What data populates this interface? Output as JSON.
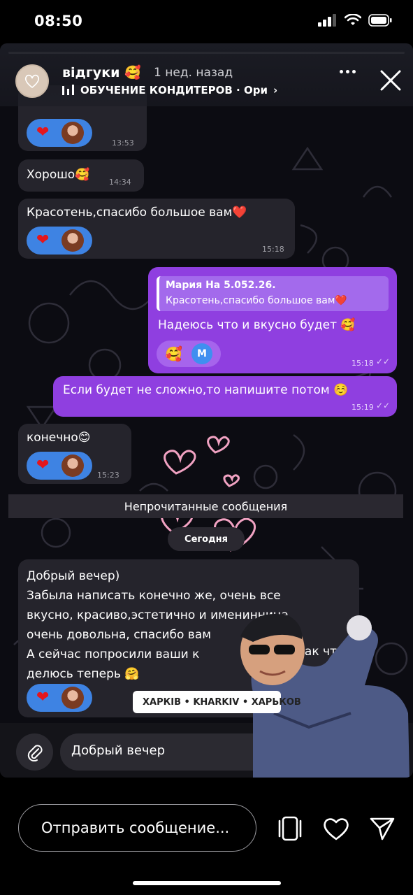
{
  "status_bar": {
    "time": "08:50"
  },
  "story": {
    "username": "відгуки 🥰",
    "time_ago": "1 нед. назад",
    "music": "ОБУЧЕНИЕ КОНДИТЕРОВ · Ори",
    "location_sticker": "ХАРКІВ • KHARKIV • ХАРЬКОВ"
  },
  "chat": {
    "top_partial": {
      "time": "13:53"
    },
    "msg1": {
      "text": "Хорошо🥰",
      "time": "14:34"
    },
    "msg2": {
      "text": "Красотень,спасибо большое вам❤️",
      "time": "15:18"
    },
    "msg3": {
      "quote_author": "Мария На 5.052.26.",
      "quote_text": "Красотень,спасибо большое вам❤️",
      "text": "Надеюсь что и вкусно будет 🥰",
      "time": "15:18",
      "reaction_emoji": "🥰",
      "reaction_initial": "М"
    },
    "msg4": {
      "text": "Если будет не сложно,то напишите потом ☺️",
      "time": "15:19"
    },
    "msg5": {
      "text": "конечно😊",
      "time": "15:23"
    },
    "unread_divider": "Непрочитанные сообщения",
    "date_pill": "Сегодня",
    "msg6": {
      "lines": [
        "Добрый вечер)",
        "Забыла написать конечно же, очень все",
        "вкусно, красиво,эстетично и именинница",
        "очень довольна, спасибо вам",
        "А сейчас попросили ваши к",
        "делюсь теперь 🤗"
      ],
      "line5_tail": "так что"
    },
    "input_text": "Добрый вечер"
  },
  "bottom": {
    "reply_placeholder": "Отправить сообщение..."
  },
  "colors": {
    "outgoing": "#8f3fe0",
    "incoming": "#25242c",
    "reaction": "#3e83e3",
    "heart": "#e4161c"
  }
}
